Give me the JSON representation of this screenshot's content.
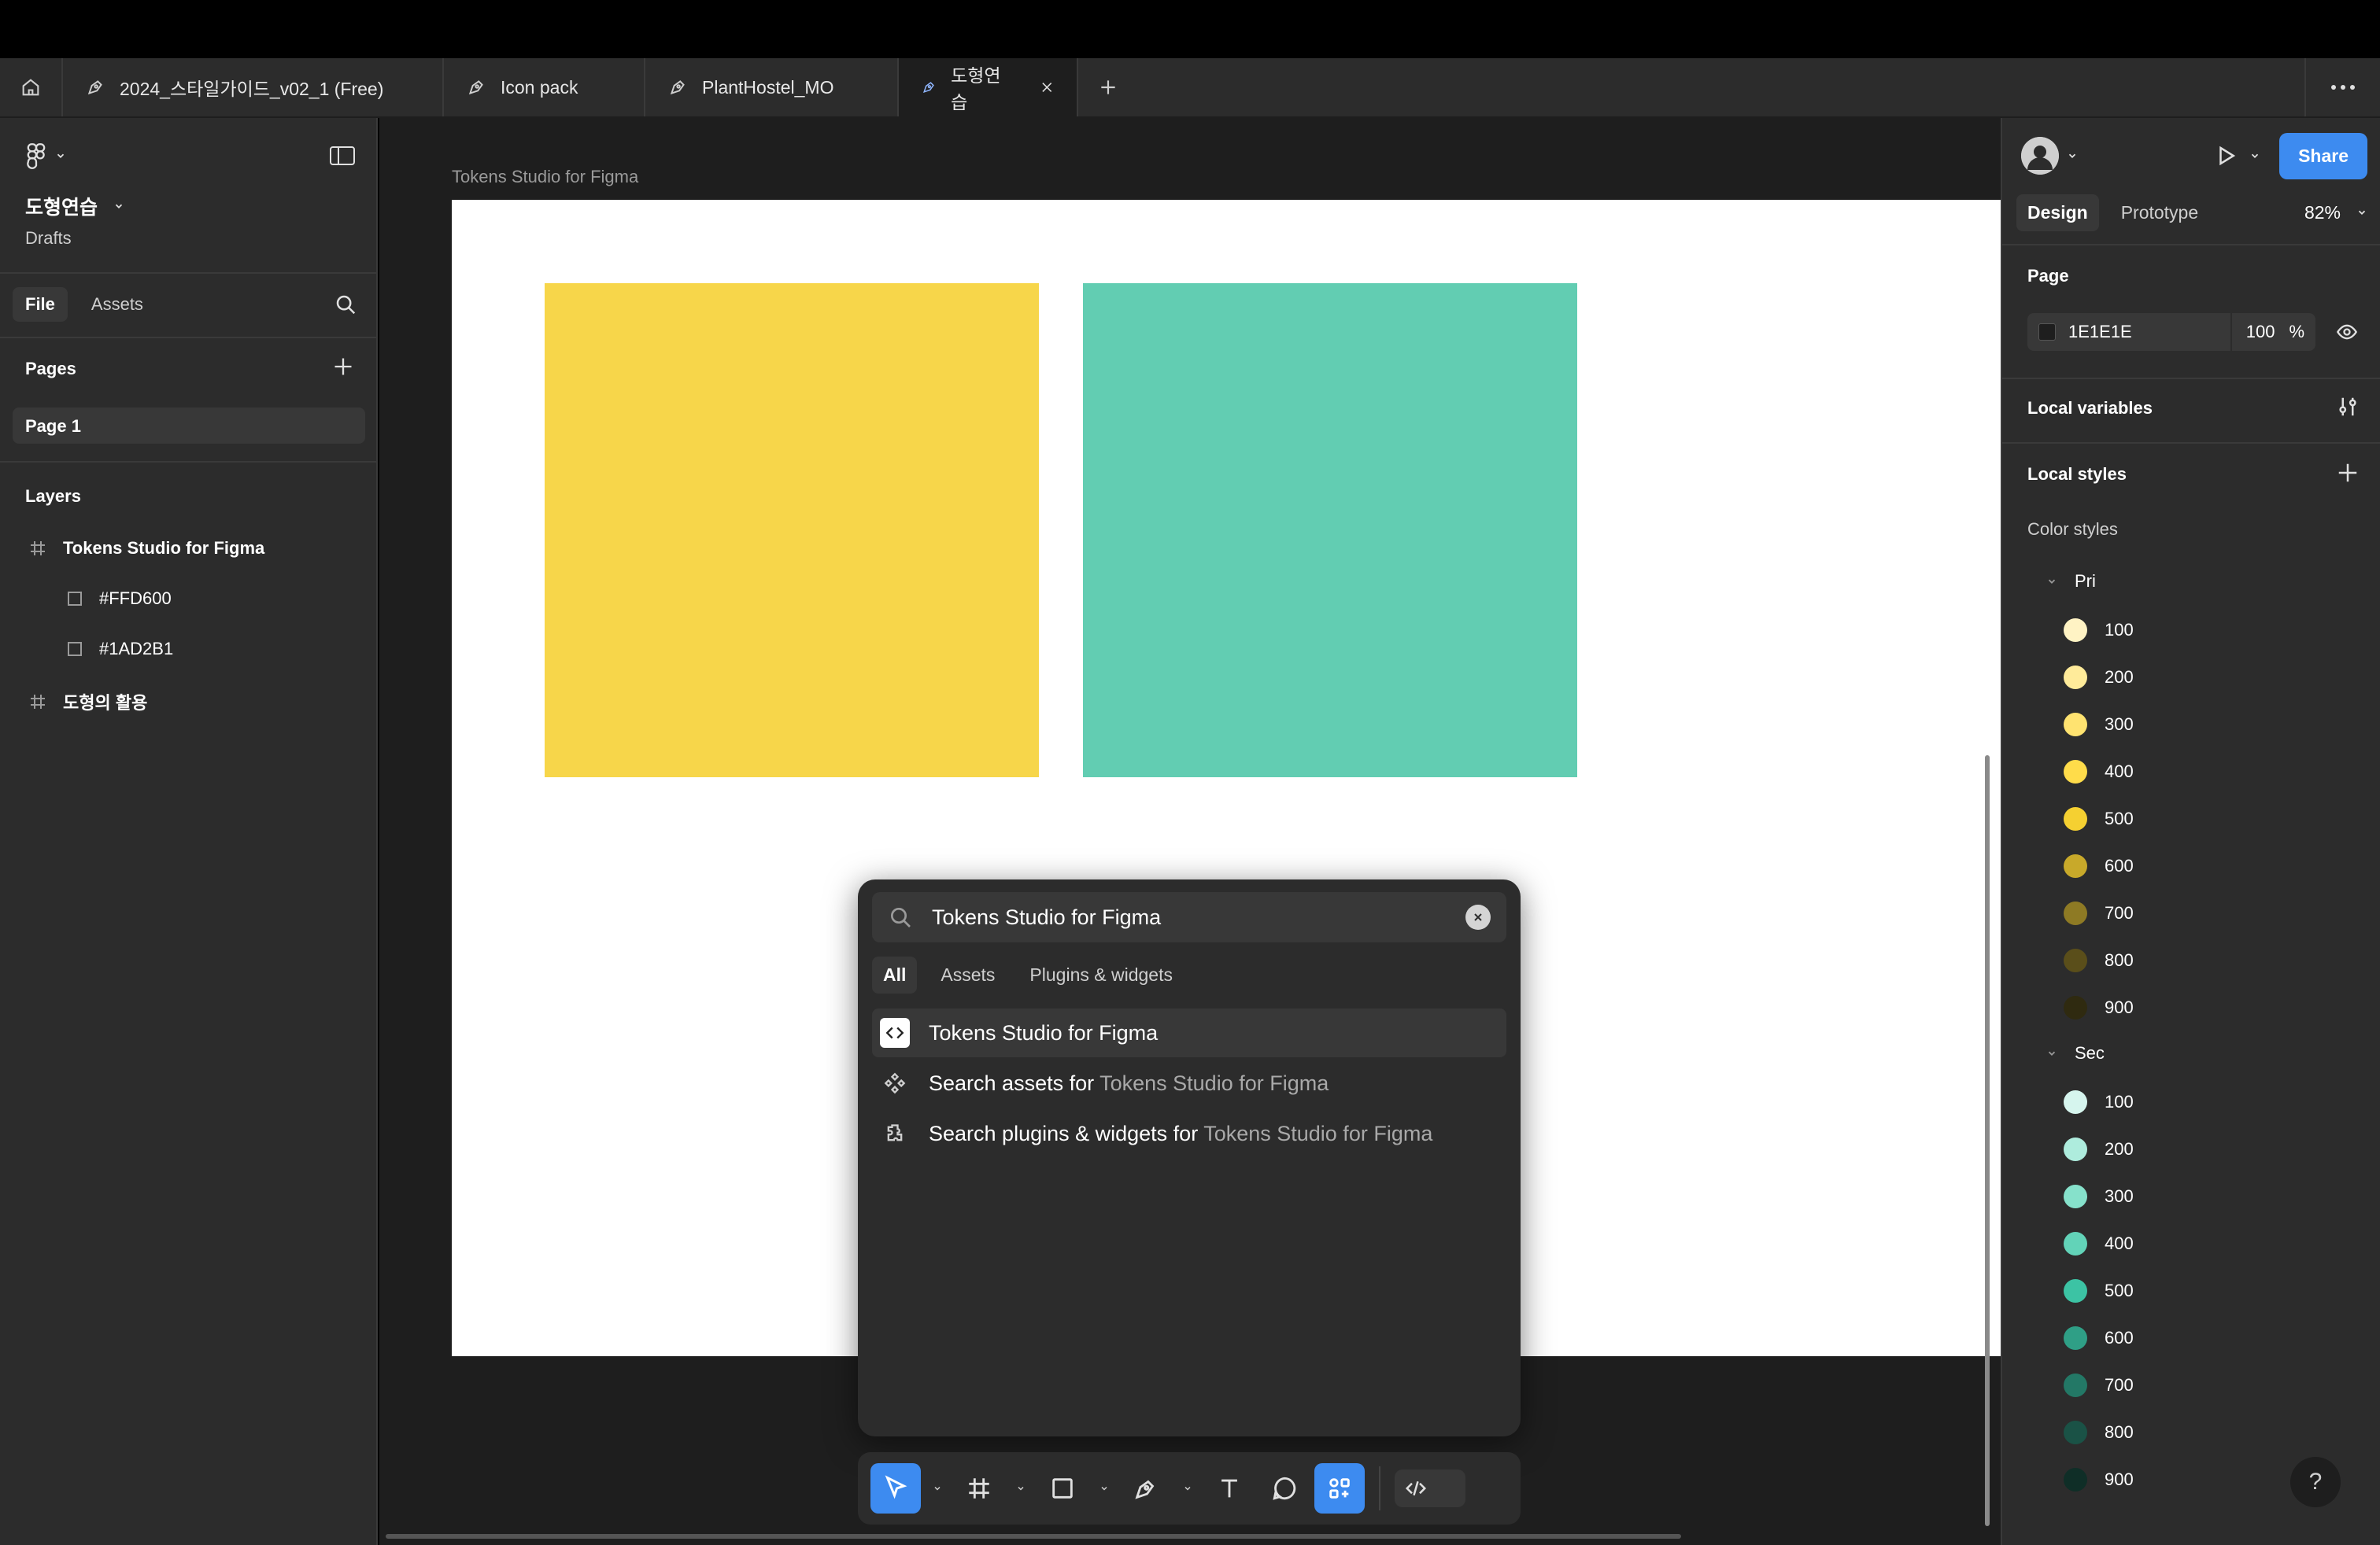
{
  "tabs": {
    "items": [
      {
        "label": "2024_스타일가이드_v02_1 (Free)"
      },
      {
        "label": "Icon pack"
      },
      {
        "label": "PlantHostel_MO"
      },
      {
        "label": "도형연습"
      }
    ]
  },
  "left_panel": {
    "file_title": "도형연습",
    "file_subtitle": "Drafts",
    "tab_file": "File",
    "tab_assets": "Assets",
    "pages_heading": "Pages",
    "pages": [
      {
        "label": "Page 1"
      }
    ],
    "layers_heading": "Layers",
    "layers": [
      {
        "label": "Tokens Studio for Figma",
        "type": "frame"
      },
      {
        "label": "#FFD600",
        "type": "rect"
      },
      {
        "label": "#1AD2B1",
        "type": "rect"
      },
      {
        "label": "도형의 활용",
        "type": "frame"
      }
    ]
  },
  "canvas": {
    "frame_label": "Tokens Studio for Figma",
    "shapes": [
      {
        "name": "#FFD600",
        "color": "#f7d64a"
      },
      {
        "name": "#1AD2B1",
        "color": "#62cdb2"
      }
    ]
  },
  "quick_actions": {
    "query": "Tokens Studio for Figma",
    "filters": [
      "All",
      "Assets",
      "Plugins & widgets"
    ],
    "results": [
      {
        "label": "Tokens Studio for Figma",
        "suffix": "",
        "icon": "plugin-code-icon"
      },
      {
        "label": "Search assets for ",
        "suffix": "Tokens Studio for Figma",
        "icon": "component-icon"
      },
      {
        "label": "Search plugins & widgets for ",
        "suffix": "Tokens Studio for Figma",
        "icon": "plugin-icon"
      }
    ]
  },
  "toolbar": {
    "tools": [
      "move-tool",
      "frame-tool",
      "rectangle-tool",
      "pen-tool",
      "text-tool",
      "comment-tool",
      "actions-tool",
      "dev-mode-toggle"
    ],
    "active_color": "#3d8bf0"
  },
  "right_panel": {
    "share_label": "Share",
    "tab_design": "Design",
    "tab_prototype": "Prototype",
    "zoom": "82%",
    "page_heading": "Page",
    "page_color_hex": "1E1E1E",
    "page_opacity": "100",
    "page_opacity_unit": "%",
    "local_variables": "Local variables",
    "local_styles": "Local styles",
    "color_styles": "Color styles",
    "groups": [
      {
        "name": "Pri",
        "swatches": [
          {
            "label": "100",
            "color": "#fff3c4"
          },
          {
            "label": "200",
            "color": "#ffeb9a"
          },
          {
            "label": "300",
            "color": "#ffe370"
          },
          {
            "label": "400",
            "color": "#ffdc4a"
          },
          {
            "label": "500",
            "color": "#f5d031"
          },
          {
            "label": "600",
            "color": "#c8a92a"
          },
          {
            "label": "700",
            "color": "#8e7a24"
          },
          {
            "label": "800",
            "color": "#5a4e1a"
          },
          {
            "label": "900",
            "color": "#2f2a10"
          }
        ]
      },
      {
        "name": "Sec",
        "swatches": [
          {
            "label": "100",
            "color": "#d6f5ee"
          },
          {
            "label": "200",
            "color": "#aeecdd"
          },
          {
            "label": "300",
            "color": "#86e1cb"
          },
          {
            "label": "400",
            "color": "#62d3b8"
          },
          {
            "label": "500",
            "color": "#3cc3a4"
          },
          {
            "label": "600",
            "color": "#2f9f86"
          },
          {
            "label": "700",
            "color": "#237866"
          },
          {
            "label": "800",
            "color": "#1a5246"
          },
          {
            "label": "900",
            "color": "#0f2e27"
          }
        ]
      }
    ],
    "help_label": "?"
  }
}
